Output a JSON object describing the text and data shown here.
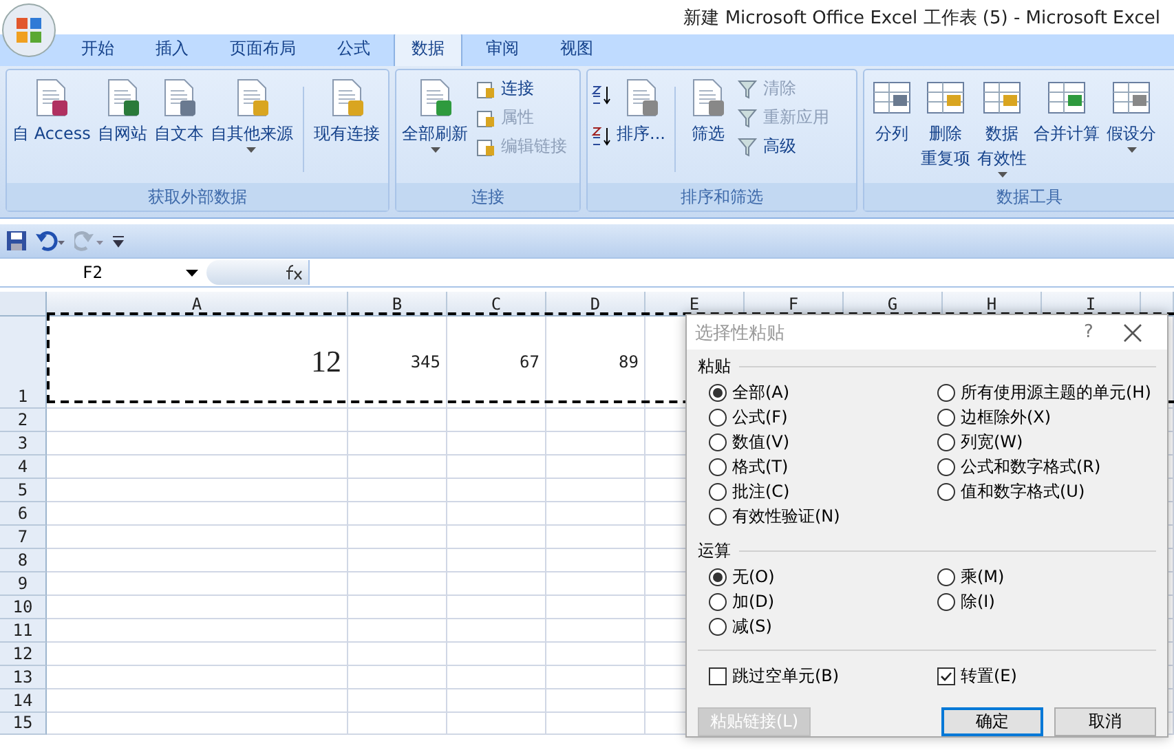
{
  "window": {
    "title": "新建 Microsoft Office Excel 工作表 (5) - Microsoft Excel"
  },
  "tabs": [
    {
      "label": "开始",
      "selected": false
    },
    {
      "label": "插入",
      "selected": false
    },
    {
      "label": "页面布局",
      "selected": false
    },
    {
      "label": "公式",
      "selected": false
    },
    {
      "label": "数据",
      "selected": true
    },
    {
      "label": "审阅",
      "selected": false
    },
    {
      "label": "视图",
      "selected": false
    }
  ],
  "ribbon": {
    "groups": [
      {
        "title": "获取外部数据",
        "items": [
          {
            "kind": "large",
            "lines": [
              "自 Access"
            ],
            "dropdown": false
          },
          {
            "kind": "large",
            "lines": [
              "自网站"
            ],
            "dropdown": false
          },
          {
            "kind": "large",
            "lines": [
              "自文本"
            ],
            "dropdown": false
          },
          {
            "kind": "large",
            "lines": [
              "自其他来源"
            ],
            "dropdown": true
          },
          {
            "kind": "separator"
          },
          {
            "kind": "large",
            "lines": [
              "现有连接"
            ],
            "dropdown": false
          }
        ]
      },
      {
        "title": "连接",
        "items": [
          {
            "kind": "large",
            "lines": [
              "全部刷新"
            ],
            "dropdown": true
          },
          {
            "kind": "stack",
            "entries": [
              {
                "label": "连接",
                "disabled": false
              },
              {
                "label": "属性",
                "disabled": true
              },
              {
                "label": "编辑链接",
                "disabled": true
              }
            ]
          }
        ]
      },
      {
        "title": "排序和筛选",
        "items": [
          {
            "kind": "sort_pair"
          },
          {
            "kind": "large",
            "lines": [
              "排序..."
            ],
            "dropdown": false
          },
          {
            "kind": "separator"
          },
          {
            "kind": "large",
            "lines": [
              "筛选"
            ],
            "dropdown": false
          },
          {
            "kind": "stack",
            "entries": [
              {
                "label": "清除",
                "disabled": true
              },
              {
                "label": "重新应用",
                "disabled": true
              },
              {
                "label": "高级",
                "disabled": false
              }
            ]
          }
        ]
      },
      {
        "title": "数据工具",
        "items": [
          {
            "kind": "large",
            "lines": [
              "分列"
            ],
            "dropdown": false
          },
          {
            "kind": "large",
            "lines": [
              "删除",
              "重复项"
            ],
            "dropdown": false
          },
          {
            "kind": "large",
            "lines": [
              "数据",
              "有效性"
            ],
            "dropdown": true
          },
          {
            "kind": "large",
            "lines": [
              "合并计算"
            ],
            "dropdown": false
          },
          {
            "kind": "large",
            "lines": [
              "假设分"
            ],
            "dropdown": true
          }
        ]
      }
    ]
  },
  "name_box": {
    "value": "F2"
  },
  "sheet": {
    "columns": [
      "A",
      "B",
      "C",
      "D",
      "E",
      "F",
      "G",
      "H",
      "I",
      ""
    ],
    "rows": [
      {
        "header": "1",
        "cells": [
          "12",
          "345",
          "67",
          "89"
        ]
      },
      {
        "header": "2",
        "cells": []
      },
      {
        "header": "3",
        "cells": []
      },
      {
        "header": "4",
        "cells": []
      },
      {
        "header": "5",
        "cells": []
      },
      {
        "header": "6",
        "cells": []
      },
      {
        "header": "7",
        "cells": []
      },
      {
        "header": "8",
        "cells": []
      },
      {
        "header": "9",
        "cells": []
      },
      {
        "header": "10",
        "cells": []
      },
      {
        "header": "11",
        "cells": []
      },
      {
        "header": "12",
        "cells": []
      },
      {
        "header": "13",
        "cells": []
      },
      {
        "header": "14",
        "cells": []
      },
      {
        "header": "15",
        "cells": []
      }
    ]
  },
  "dialog": {
    "title": "选择性粘贴",
    "help": "?",
    "paste": {
      "label": "粘贴",
      "options": [
        {
          "label": "全部(A)",
          "selected": true
        },
        {
          "label": "公式(F)",
          "selected": false
        },
        {
          "label": "数值(V)",
          "selected": false
        },
        {
          "label": "格式(T)",
          "selected": false
        },
        {
          "label": "批注(C)",
          "selected": false
        },
        {
          "label": "有效性验证(N)",
          "selected": false
        },
        {
          "label": "所有使用源主题的单元(H)",
          "selected": false
        },
        {
          "label": "边框除外(X)",
          "selected": false
        },
        {
          "label": "列宽(W)",
          "selected": false
        },
        {
          "label": "公式和数字格式(R)",
          "selected": false
        },
        {
          "label": "值和数字格式(U)",
          "selected": false
        }
      ]
    },
    "operation": {
      "label": "运算",
      "options": [
        {
          "label": "无(O)",
          "selected": true
        },
        {
          "label": "加(D)",
          "selected": false
        },
        {
          "label": "减(S)",
          "selected": false
        },
        {
          "label": "乘(M)",
          "selected": false
        },
        {
          "label": "除(I)",
          "selected": false
        }
      ]
    },
    "checkboxes": [
      {
        "label": "跳过空单元(B)",
        "checked": false
      },
      {
        "label": "转置(E)",
        "checked": true
      }
    ],
    "buttons": [
      {
        "label": "粘贴链接(L)",
        "disabled": true,
        "default": false
      },
      {
        "label": "确定",
        "disabled": false,
        "default": true
      },
      {
        "label": "取消",
        "disabled": false,
        "default": false
      }
    ]
  }
}
